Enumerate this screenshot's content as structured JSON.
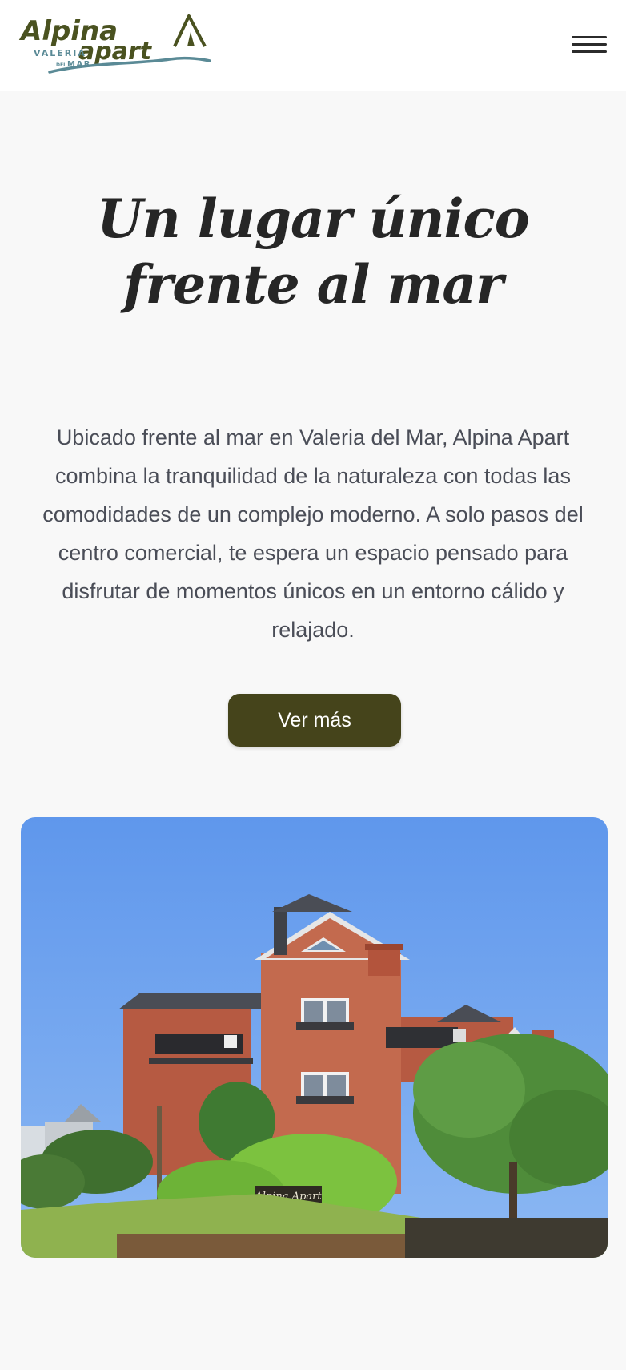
{
  "header": {
    "logo": {
      "name_line1": "Alpina",
      "name_line2": "apart",
      "place_line1": "VALERIA",
      "place_line2_small": "DEL",
      "place_line2": "MAR"
    },
    "menu_icon": "hamburger-menu-icon"
  },
  "hero": {
    "title_line1": "Un lugar único",
    "title_line2": "frente al mar",
    "description": "Ubicado frente al mar en Valeria del Mar, Alpina Apart combina la tranquilidad de la naturaleza con todas las comodidades de un complejo moderno. A solo pasos del centro comercial, te espera un espacio pensado para disfrutar de momentos únicos en un entorno cálido y relajado.",
    "cta_label": "Ver más"
  },
  "photo": {
    "sign_text": "Alpina Apart"
  },
  "colors": {
    "logo_green": "#4a5220",
    "logo_teal": "#5a8a96",
    "button_bg": "#45441b",
    "page_bg": "#f8f8f8",
    "title_color": "#262626",
    "text_color": "#4a4d57"
  }
}
